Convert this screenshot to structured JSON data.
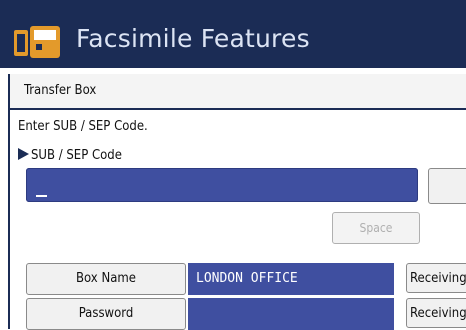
{
  "window": {
    "title": "Facsimile Features"
  },
  "breadcrumb": {
    "label": "Transfer Box"
  },
  "form": {
    "prompt": "Enter SUB / SEP Code.",
    "code_label": "SUB / SEP Code",
    "code_value": "",
    "space_label": "Space"
  },
  "rows": [
    {
      "label": "Box Name",
      "value": "LONDON OFFICE",
      "right_label": "Receiving"
    },
    {
      "label": "Password",
      "value": "",
      "right_label": "Receiving"
    }
  ],
  "colors": {
    "titlebar": "#1b2c55",
    "field": "#3f4fa0",
    "icon_orange": "#e39a2b"
  },
  "icons": {
    "app": "fax-app-icon",
    "field_marker": "triangle-right-icon"
  }
}
